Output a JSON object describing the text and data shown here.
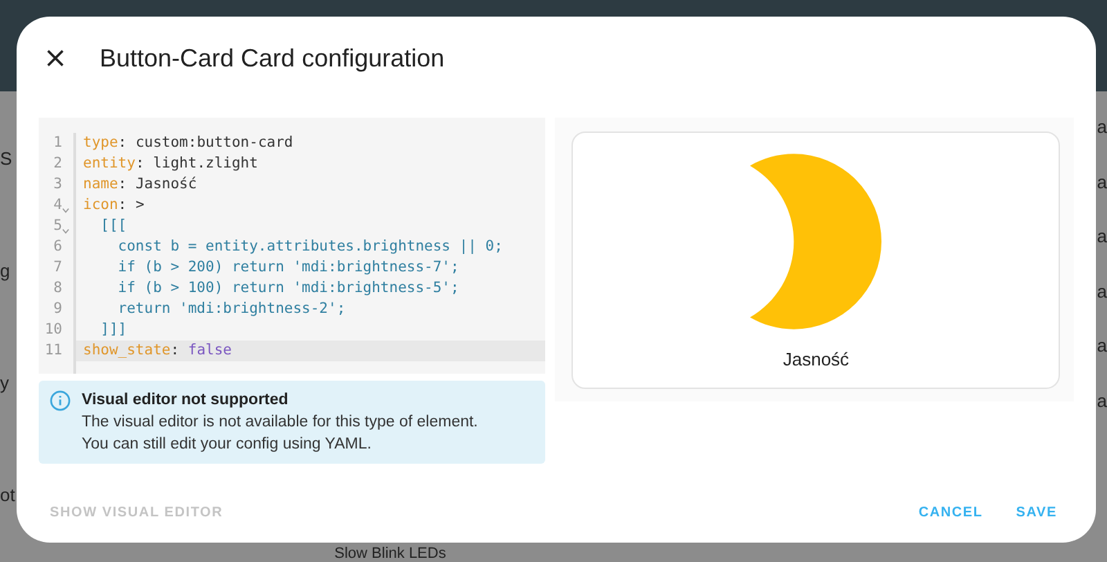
{
  "background": {
    "left_fragments": [
      "S",
      "g",
      "y",
      "ot"
    ],
    "right_fragments": [
      "a",
      "a",
      "a",
      "a",
      "a",
      "a"
    ],
    "bottom_text": "Slow Blink LEDs"
  },
  "dialog": {
    "title": "Button-Card Card configuration",
    "editor": {
      "lines": [
        {
          "number": "1",
          "fold": false,
          "active": false,
          "key": "type",
          "colon": ":",
          "value": "custom:button-card",
          "kind": "plain"
        },
        {
          "number": "2",
          "fold": false,
          "active": false,
          "key": "entity",
          "colon": ":",
          "value": "light.zlight",
          "kind": "plain"
        },
        {
          "number": "3",
          "fold": false,
          "active": false,
          "key": "name",
          "colon": ":",
          "value": "Jasność",
          "kind": "plain"
        },
        {
          "number": "4",
          "fold": true,
          "active": false,
          "key": "icon",
          "colon": ":",
          "value": ">",
          "kind": "plain"
        },
        {
          "number": "5",
          "fold": true,
          "active": false,
          "value": "  [[[",
          "kind": "script"
        },
        {
          "number": "6",
          "fold": false,
          "active": false,
          "value": "    const b = entity.attributes.brightness || 0;",
          "kind": "script"
        },
        {
          "number": "7",
          "fold": false,
          "active": false,
          "value": "    if (b > 200) return 'mdi:brightness-7';",
          "kind": "script"
        },
        {
          "number": "8",
          "fold": false,
          "active": false,
          "value": "    if (b > 100) return 'mdi:brightness-5';",
          "kind": "script"
        },
        {
          "number": "9",
          "fold": false,
          "active": false,
          "value": "    return 'mdi:brightness-2';",
          "kind": "script"
        },
        {
          "number": "10",
          "fold": false,
          "active": false,
          "value": "  ]]]",
          "kind": "script"
        },
        {
          "number": "11",
          "fold": false,
          "active": true,
          "key": "show_state",
          "colon": ":",
          "value": "false",
          "kind": "boolean"
        }
      ]
    },
    "alert": {
      "title": "Visual editor not supported",
      "lines": [
        "The visual editor is not available for this type of element.",
        "You can still edit your config using YAML."
      ]
    },
    "preview": {
      "name": "Jasność"
    },
    "buttons": {
      "toggle": {
        "label": "SHOW VISUAL EDITOR",
        "disabled": true
      },
      "cancel": "CANCEL",
      "save": "SAVE"
    }
  }
}
